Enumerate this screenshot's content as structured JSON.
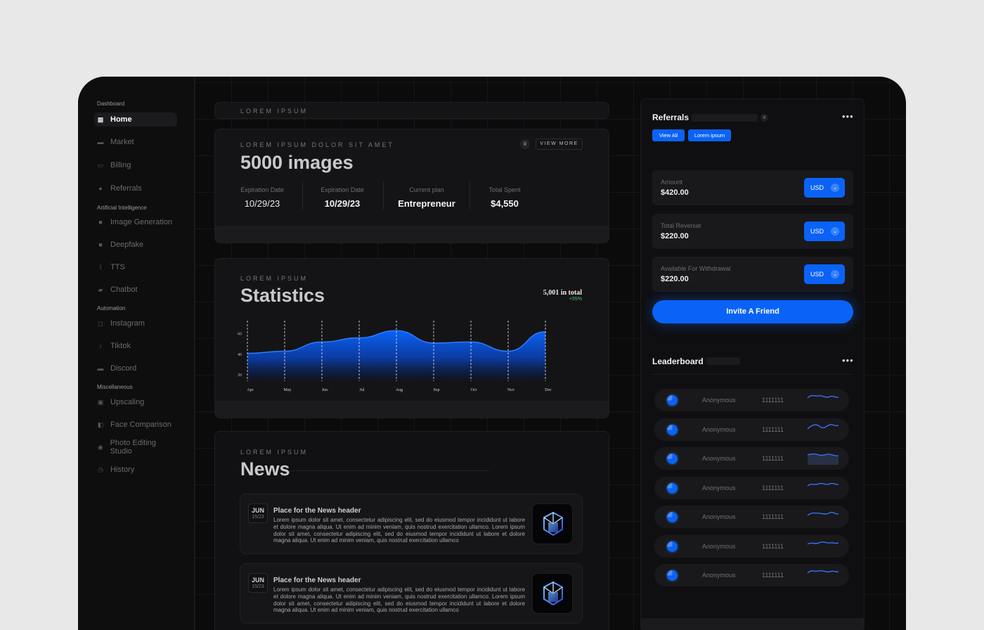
{
  "sidebar": {
    "sections": {
      "dashboard": "Dashboard",
      "ai": "Artificial Intelligence",
      "automation": "Automation",
      "misc": "Miscellaneous"
    },
    "items": [
      {
        "label": "Home",
        "icon": "grid-icon"
      },
      {
        "label": "Market",
        "icon": "store-icon"
      },
      {
        "label": "Billing",
        "icon": "card-icon"
      },
      {
        "label": "Referrals",
        "icon": "coin-icon"
      },
      {
        "label": "Image Generation",
        "icon": "image-icon"
      },
      {
        "label": "Deepfake",
        "icon": "video-icon"
      },
      {
        "label": "TTS",
        "icon": "mic-icon"
      },
      {
        "label": "Chatbot",
        "icon": "chat-icon"
      },
      {
        "label": "Instagram",
        "icon": "instagram-icon"
      },
      {
        "label": "Tiktok",
        "icon": "tiktok-icon"
      },
      {
        "label": "Discord",
        "icon": "discord-icon"
      },
      {
        "label": "Upscaling",
        "icon": "upscale-icon"
      },
      {
        "label": "Face Comparison",
        "icon": "face-compare-icon"
      },
      {
        "label": "Photo Editing Studio",
        "icon": "photo-edit-icon"
      },
      {
        "label": "History",
        "icon": "history-icon"
      }
    ]
  },
  "top_bar": {
    "label": "LOREM IPSUM"
  },
  "plan_card": {
    "eyebrow": "LOREM IPSUM DOLOR SIT AMET",
    "title": "5000 images",
    "view_more": "VIEW MORE",
    "stats": [
      {
        "label": "Expiration Date",
        "value": "10/29/23"
      },
      {
        "label": "Expiration Date",
        "value": "10/29/23"
      },
      {
        "label": "Current plan",
        "value": "Entrepreneur"
      },
      {
        "label": "Total Spent",
        "value": "$4,550"
      }
    ]
  },
  "stats_card": {
    "eyebrow": "LOREM IPSUM",
    "title": "Statistics",
    "total": "5,001 in total",
    "change": "+55%",
    "change_color": "#3ec46d"
  },
  "chart_data": {
    "type": "area",
    "x": [
      "Apr",
      "May",
      "Jun",
      "Jul",
      "Aug",
      "Sep",
      "Oct",
      "Nov",
      "Dec"
    ],
    "y_ticks": [
      20,
      40,
      60
    ],
    "ylim": [
      14,
      70
    ],
    "values": [
      41,
      43,
      52,
      56,
      63,
      51,
      52,
      43,
      62
    ],
    "grid": "dashed vertical",
    "color": "#0a63f6"
  },
  "news": {
    "eyebrow": "LOREM IPSUM",
    "title": "News",
    "items": [
      {
        "month": "JUN",
        "day": "15/23",
        "header": "Place for the News header",
        "body": "Lorem ipsum dolor sit amet, consectetur adipiscing elit, sed do eiusmod tempor incididunt ut labore et dolore magna aliqua. Ut enim ad minim veniam, quis nostrud exercitation ullamco. Lorem ipsum dolor sit amet, consectetur adipiscing elit, sed do eiusmod tempor incididunt ut labore et dolore magna aliqua. Ut enim ad minim veniam, quis nostrud exercitation ullamco"
      },
      {
        "month": "JUN",
        "day": "15/23",
        "header": "Place for the News header",
        "body": "Lorem ipsum dolor sit amet, consectetur adipiscing elit, sed do eiusmod tempor incididunt ut labore et dolore magna aliqua. Ut enim ad minim veniam, quis nostrud exercitation ullamco. Lorem ipsum dolor sit amet, consectetur adipiscing elit, sed do eiusmod tempor incididunt ut labore et dolore magna aliqua. Ut enim ad minim veniam, quis nostrud exercitation ullamco"
      }
    ]
  },
  "referrals": {
    "title": "Referrals",
    "btn_view_all": "View All",
    "btn_lorem": "Lorem ipsum",
    "accent": "#0a63f6",
    "amounts": [
      {
        "label": "Amount",
        "value": "$420.00",
        "currency": "USD"
      },
      {
        "label": "Total Revenue",
        "value": "$220.00",
        "currency": "USD"
      },
      {
        "label": "Available For Withdrawal",
        "value": "$220.00",
        "currency": "USD"
      }
    ],
    "invite": "Invite A Friend"
  },
  "leaderboard": {
    "title": "Leaderboard",
    "rows": [
      {
        "name": "Anonymous",
        "score": "1111111"
      },
      {
        "name": "Anonymous",
        "score": "1111111"
      },
      {
        "name": "Anonymous",
        "score": "1111111"
      },
      {
        "name": "Anonymous",
        "score": "1111111"
      },
      {
        "name": "Anonymous",
        "score": "1111111"
      },
      {
        "name": "Anonymous",
        "score": "1111111"
      },
      {
        "name": "Anonymous",
        "score": "1111111"
      }
    ]
  }
}
